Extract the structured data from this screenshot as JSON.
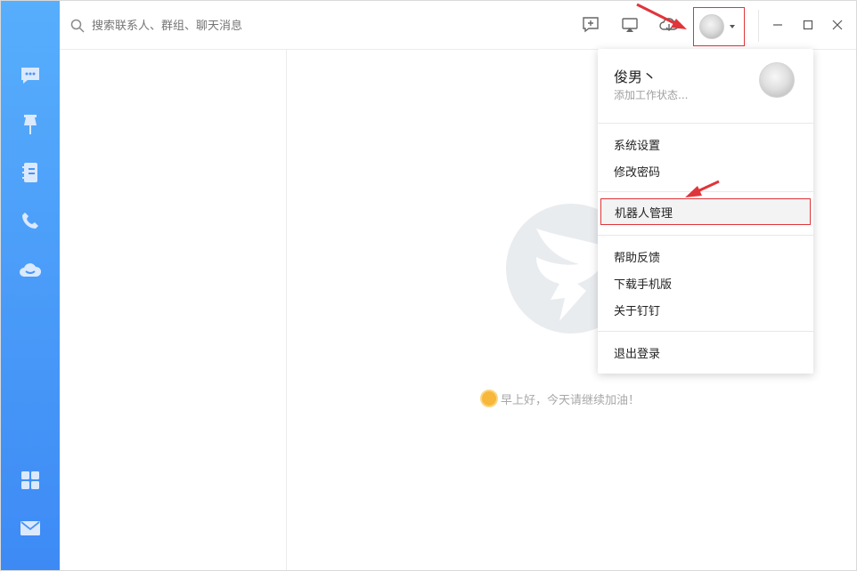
{
  "search": {
    "placeholder": "搜索联系人、群组、聊天消息"
  },
  "sidebar": {
    "items": [
      {
        "icon": "chat-bubble-icon"
      },
      {
        "icon": "pin-icon"
      },
      {
        "icon": "contacts-book-icon"
      },
      {
        "icon": "phone-icon"
      },
      {
        "icon": "cloud-icon"
      },
      {
        "icon": "apps-grid-icon"
      },
      {
        "icon": "mail-icon"
      }
    ]
  },
  "toolbar": {
    "icons": [
      "new-chat-icon",
      "screen-cast-icon",
      "cloud-drive-icon"
    ],
    "window_controls": [
      "minimize-icon",
      "maximize-icon",
      "close-icon"
    ]
  },
  "main": {
    "greeting": "早上好，今天请继续加油！"
  },
  "menu": {
    "user_name": "俊男丶",
    "status_placeholder": "添加工作状态...",
    "items": {
      "settings": "系统设置",
      "change_password": "修改密码",
      "robot_manage": "机器人管理",
      "help_feedback": "帮助反馈",
      "download_mobile": "下载手机版",
      "about": "关于钉钉",
      "logout": "退出登录"
    }
  },
  "colors": {
    "rail_top": "#57aefc",
    "rail_bottom": "#3d8af5",
    "highlight_red": "#e0353a"
  }
}
